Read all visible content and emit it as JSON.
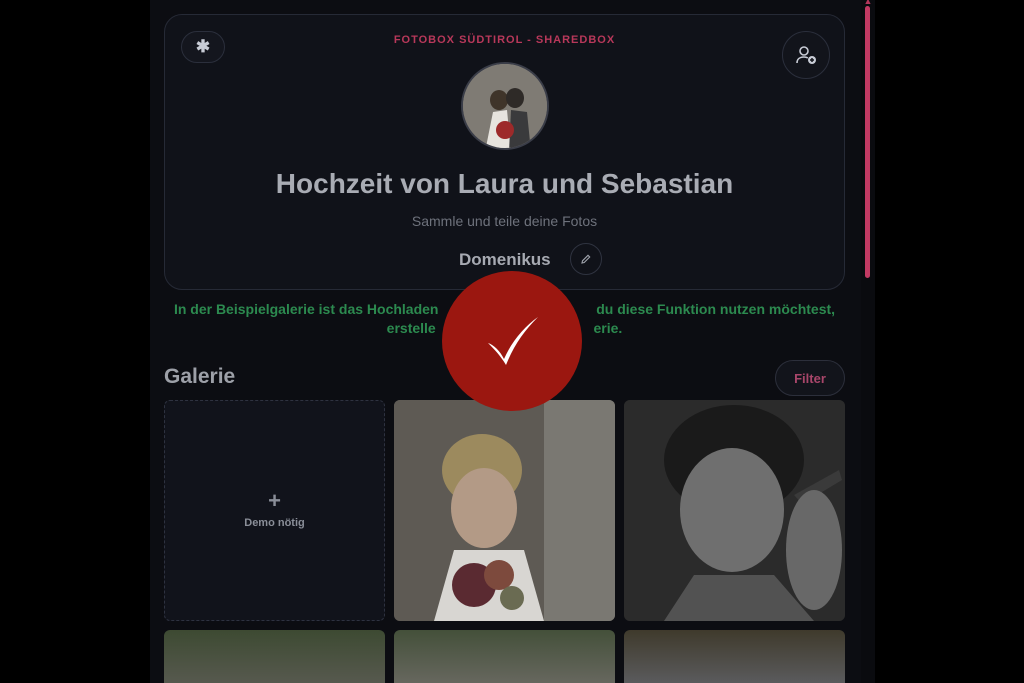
{
  "header": {
    "brand": "FOTOBOX SÜDTIROL - SHAREDBOX",
    "title": "Hochzeit von Laura und Sebastian",
    "subtitle": "Sammle und teile deine Fotos",
    "username": "Domenikus",
    "logo_icon": "asterisk-icon",
    "add_user_icon": "user-plus-icon",
    "edit_icon": "pencil-icon"
  },
  "notice": {
    "line1_left": "In der Beispielgalerie ist das Hochladen",
    "line1_right": "du diese Funktion nutzen möchtest,",
    "line2_left": "erstelle",
    "line2_right": "erie."
  },
  "gallery": {
    "title": "Galerie",
    "filter_label": "Filter",
    "upload_plus": "+",
    "upload_label": "Demo nötig"
  },
  "colors": {
    "accent": "#c23a63",
    "notice_green": "#2c8a4f",
    "overlay_red": "#9b1710"
  },
  "overlay": {
    "icon": "checkmark-icon"
  }
}
